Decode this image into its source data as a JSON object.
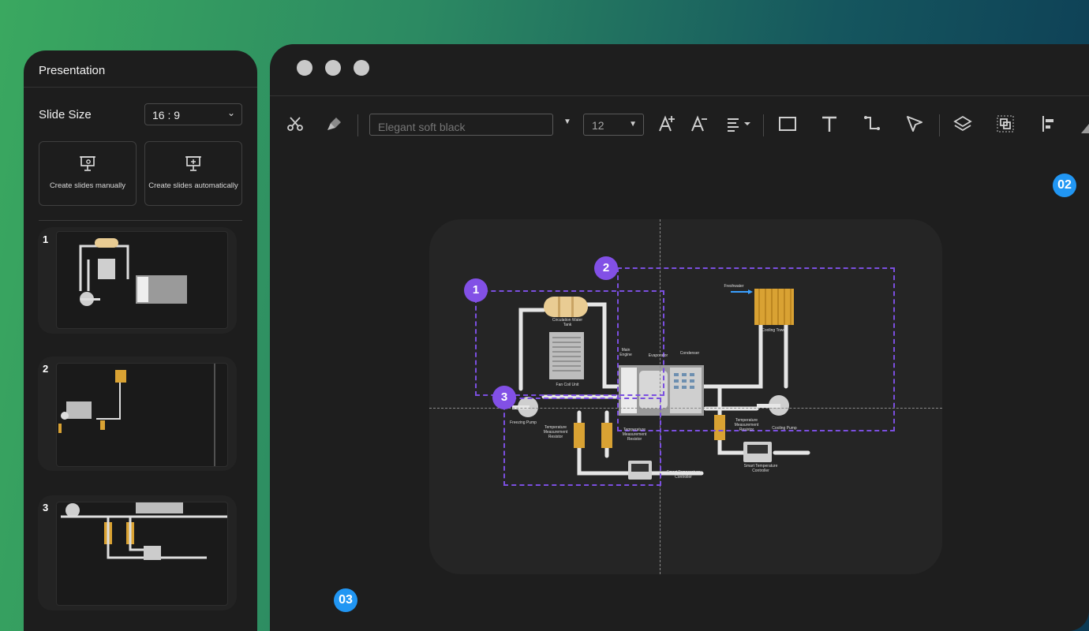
{
  "panel": {
    "title": "Presentation",
    "slide_size_label": "Slide Size",
    "slide_size_value": "16 : 9",
    "create_manual": "Create slides manually",
    "create_auto": "Create slides automatically",
    "slides": [
      {
        "number": "1"
      },
      {
        "number": "2"
      },
      {
        "number": "3"
      }
    ]
  },
  "toolbar": {
    "font_placeholder": "Elegant soft black",
    "font_size": "12",
    "icons": [
      "scissors-icon",
      "format-painter-icon",
      "font-dropdown-icon",
      "increase-font-icon",
      "decrease-font-icon",
      "align-icon",
      "rectangle-icon",
      "text-icon",
      "connector-icon",
      "pointer-icon",
      "layers-icon",
      "group-icon",
      "align-left-icon"
    ]
  },
  "badges": {
    "b02": "02",
    "b03": "03"
  },
  "diagram": {
    "regions": [
      "1",
      "2",
      "3"
    ],
    "labels": {
      "circulation_tank": "Circulation Water Tank",
      "fan_coil": "Fan Coil Unit",
      "main_engine": "Main Engine",
      "evaporator": "Evaporator",
      "condenser": "Condenser",
      "freshwater": "Freshwater",
      "cooling_tower": "Cooling Tower",
      "freezing_pump": "Freezing Pump",
      "temp_resistor_1": "Temperature Measurement Resistor",
      "temp_resistor_2": "Temperature Measurement Resistor",
      "temp_resistor_3": "Temperature Measurement Resistor",
      "cooling_pump": "Cooling Pump",
      "smart_controller_1": "Smart Temperature Controller",
      "smart_controller_2": "Smart Temperature Controller"
    }
  }
}
